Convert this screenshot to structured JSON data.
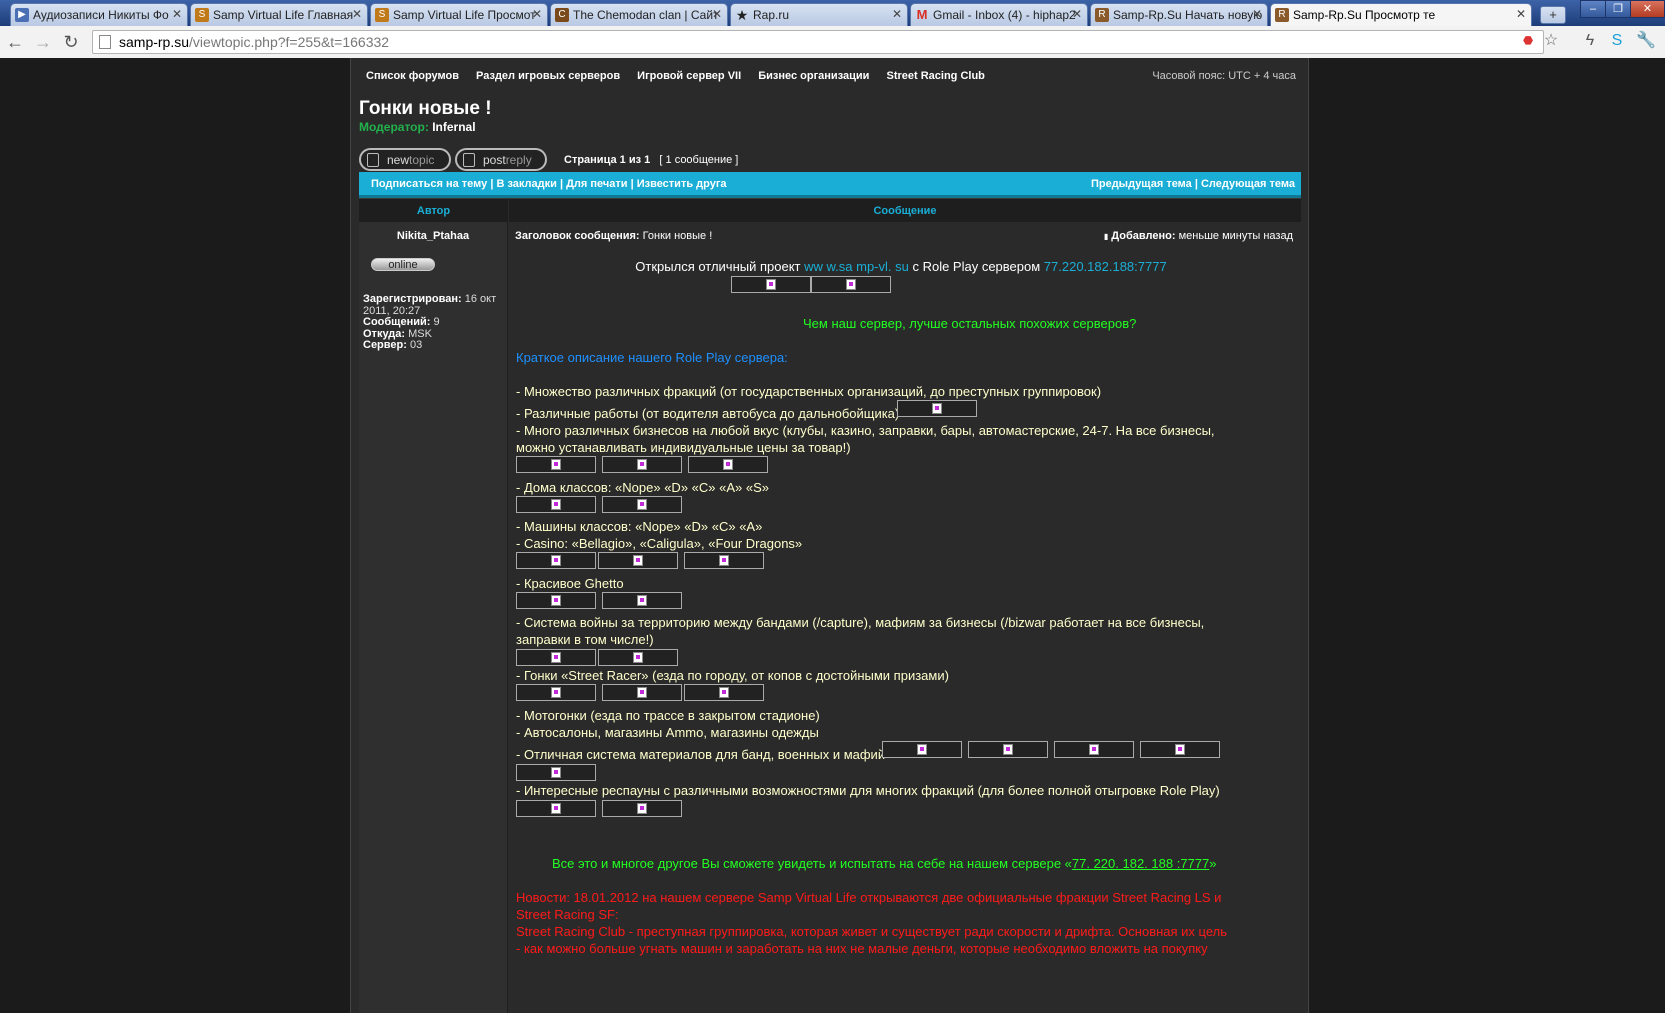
{
  "browser": {
    "tabs": [
      {
        "title": "Аудиозаписи Никиты Фо",
        "icon": "play-icon",
        "color": "#4a6fb5"
      },
      {
        "title": "Samp Virtual Life Главная",
        "icon": "samp-icon",
        "color": "#c07a1a"
      },
      {
        "title": "Samp Virtual Life Просмот",
        "icon": "samp-icon",
        "color": "#c07a1a"
      },
      {
        "title": "The Chemodan clan | Сайт",
        "icon": "suitcase-icon",
        "color": "#7a4a1a"
      },
      {
        "title": "Rap.ru",
        "icon": "star-icon",
        "color": "#222222"
      },
      {
        "title": "Gmail - Inbox (4) - hiphap2",
        "icon": "gmail-icon",
        "color": "#d93025"
      },
      {
        "title": "Samp-Rp.Su Начать новую",
        "icon": "samp-rp-icon",
        "color": "#8a5a2a"
      },
      {
        "title": "Samp-Rp.Su Просмотр те",
        "icon": "samp-rp-icon",
        "color": "#8a5a2a"
      }
    ],
    "address": {
      "host": "samp-rp.su",
      "path": "/viewtopic.php?f=255&t=166332"
    }
  },
  "forum": {
    "breadcrumbs": [
      "Список форумов",
      "Раздел игровых серверов",
      "Игровой сервер VII",
      "Бизнес организации",
      "Street Racing Club"
    ],
    "timezone": "Часовой пояс: UTC + 4 часа",
    "topic_title": "Гонки новые !",
    "moderator_label": "Модератор:",
    "moderator": "Infernal",
    "buttons": {
      "newtopic_a": "new",
      "newtopic_b": "topic",
      "postreply_a": "post",
      "postreply_b": "reply"
    },
    "pagination": {
      "page": "Страница 1 из 1",
      "count": "[ 1 сообщение ]"
    },
    "actions_left": "Подписаться на тему | В закладки | Для печати | Известить друга",
    "actions_right": "Предыдущая тема | Следующая тема",
    "col_author": "Автор",
    "col_message": "Сообщение"
  },
  "author": {
    "name": "Nikita_Ptahaa",
    "status": "online",
    "registered_label": "Зарегистрирован:",
    "registered": "16 окт 2011, 20:27",
    "posts_label": "Сообщений:",
    "posts": "9",
    "from_label": "Откуда:",
    "from": "MSK",
    "server_label": "Сервер:",
    "server": "03"
  },
  "post": {
    "subject_label": "Заголовок сообщения:",
    "subject": "Гонки новые !",
    "posted_label": "Добавлено:",
    "posted": "меньше минуты назад",
    "intro_a": "Открылся отличный проект ",
    "intro_link": "ww w.sa mp-vl. su",
    "intro_b": " с Role Play сервером ",
    "intro_ip": "77.220.182.188:7777",
    "why": "Чем наш сервер, лучше остальных похожих серверов?",
    "desc_heading": "Краткое описание нашего Role Play сервера:",
    "items": [
      "- Множество различных фракций (от государственных организаций, до преступных группировок)",
      "- Различные работы (от водителя автобуса до дальнобойщика)",
      "- Много различных бизнесов на любой вкус (клубы, казино, заправки, бары, автомастерские, 24-7. На все бизнесы,",
      "можно устанавливать индивидуальные цены за товар!)",
      "- Дома классов: «Nope» «D» «C» «A» «S»",
      "- Машины классов: «Nope» «D» «C» «A»",
      "- Casino: «Bellagio», «Caligula», «Four Dragons»",
      "- Красивое Ghetto",
      "- Система войны за территорию между бандами (/capture), мафиям за бизнесы (/bizwar работает на все бизнесы,",
      "заправки в том числе!)",
      "- Гонки «Street Racer» (езда по городу, от копов с достойными призами)",
      "- Мотогонки (езда по трассе в закрытом стадионе)",
      "- Автосалоны, магазины Ammo, магазины одежды",
      "- Отличная система материалов для банд, военных и мафий",
      "- Интересные респауны с различными возможностями для многих фракций (для более полной отыгровке Role Play)"
    ],
    "outro_a": "Все это и многое другое Вы сможете увидеть и испытать на себе на нашем сервере «",
    "outro_ip": "77. 220. 182. 188 :7777",
    "outro_b": "»",
    "news_1": "Новости: 18.01.2012 на нашем сервере Samp Virtual Life открываются две официальные фракции Street Racing LS и",
    "news_2": "Street Racing SF:",
    "news_3": "Street Racing Club - преступная группировка, которая живет и существует ради скорости и дрифта. Основная их цель",
    "news_4": "- как можно больше угнать машин и заработать на них не малые деньги, которые необходимо вложить на покупку"
  }
}
